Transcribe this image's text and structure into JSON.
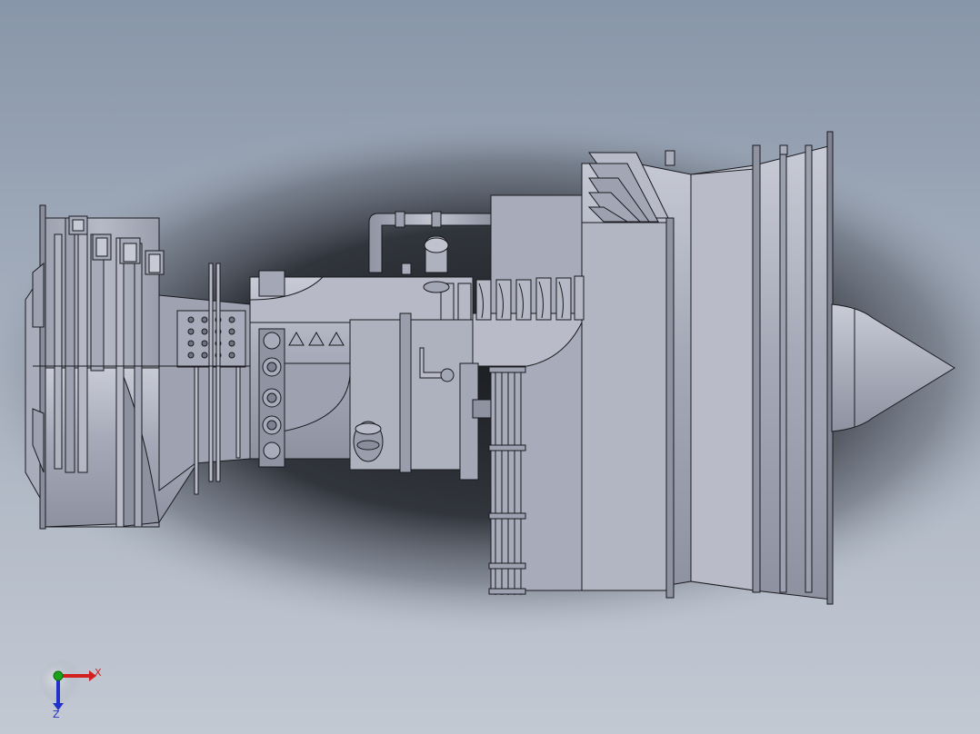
{
  "viewport": {
    "background_top": "#8a97aa",
    "background_mid": "#b7bfcc",
    "background_bottom": "#c2c9d4",
    "shadow_color": "#2a2d33",
    "model_face_color": "#a9adbb",
    "model_light_color": "#c9ccd8",
    "model_dark_color": "#7e8292",
    "edge_color": "#1a1a1f"
  },
  "model": {
    "name_icon": "gas-turbine-engine-model"
  },
  "triad": {
    "x_label": "X",
    "z_label": "Z",
    "x_color": "#d21f1f",
    "y_color": "#1aa31a",
    "z_color": "#2030c8"
  }
}
